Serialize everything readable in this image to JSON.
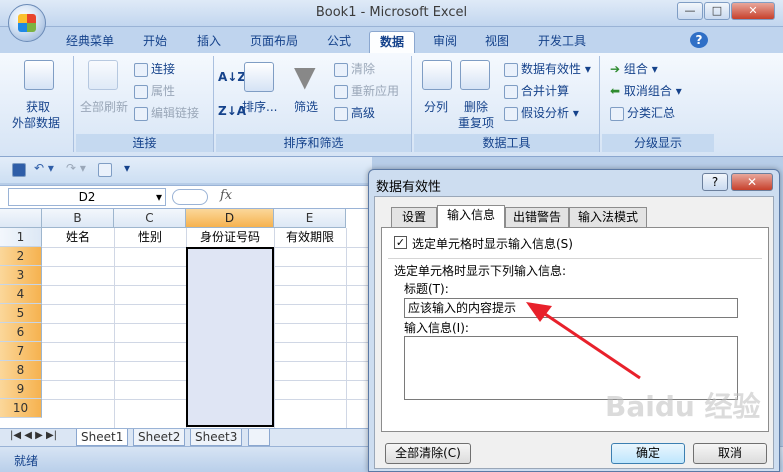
{
  "window": {
    "title": "Book1 - Microsoft Excel",
    "min": "—",
    "max": "□",
    "close": "✕"
  },
  "tabs": [
    "经典菜单",
    "开始",
    "插入",
    "页面布局",
    "公式",
    "数据",
    "审阅",
    "视图",
    "开发工具"
  ],
  "help": "?",
  "ribbon": {
    "get_external": [
      "获取",
      "外部数据"
    ],
    "refresh_all": "全部刷新",
    "connections": "连接",
    "properties": "属性",
    "edit_links": "编辑链接",
    "group_connections": "连接",
    "sort": "排序...",
    "filter": "筛选",
    "clear": "清除",
    "reapply": "重新应用",
    "advanced": "高级",
    "group_sort_filter": "排序和筛选",
    "text_to_columns": "分列",
    "remove_dup": [
      "删除",
      "重复项"
    ],
    "data_validation": "数据有效性",
    "consolidate": "合并计算",
    "what_if": "假设分析",
    "group_data_tools": "数据工具",
    "group": "组合",
    "ungroup": "取消组合",
    "subtotal": "分类汇总",
    "group_outline": "分级显示"
  },
  "formula_bar": {
    "name_box": "D2",
    "fx": "fx"
  },
  "sheet": {
    "columns": [
      "B",
      "C",
      "D",
      "E"
    ],
    "rows": [
      "1",
      "2",
      "3",
      "4",
      "5",
      "6",
      "7",
      "8",
      "9",
      "10"
    ],
    "headers": [
      "姓名",
      "性别",
      "身份证号码",
      "有效期限"
    ],
    "tabs": [
      "Sheet1",
      "Sheet2",
      "Sheet3"
    ]
  },
  "status": "就绪",
  "dialog": {
    "title": "数据有效性",
    "help": "?",
    "close": "✕",
    "tabs": [
      "设置",
      "输入信息",
      "出错警告",
      "输入法模式"
    ],
    "show_input_checkbox": "选定单元格时显示输入信息(S)",
    "section": "选定单元格时显示下列输入信息:",
    "title_label": "标题(T):",
    "title_value": "应该输入的内容提示",
    "message_label": "输入信息(I):",
    "message_value": "",
    "clear_all": "全部清除(C)",
    "ok": "确定",
    "cancel": "取消"
  },
  "watermark": "Baidu 经验",
  "colors": {
    "accent": "#15428b",
    "selected_header": "#f6b24f",
    "arrow": "#e8212b"
  }
}
